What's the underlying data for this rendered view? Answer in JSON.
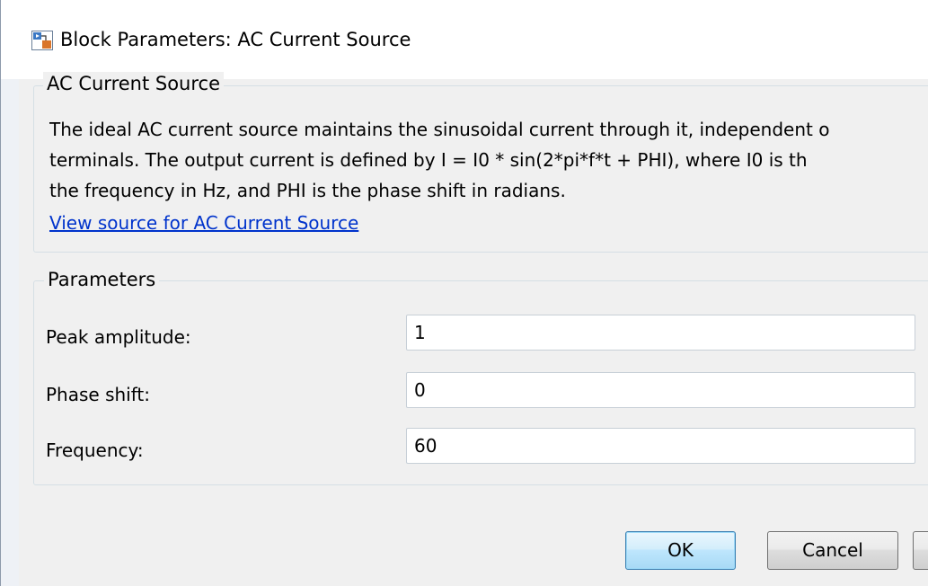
{
  "window": {
    "title": "Block Parameters: AC Current Source",
    "icon": "simulink-block-icon"
  },
  "description_group": {
    "title": "AC Current Source",
    "lines": [
      "The ideal AC current source maintains the sinusoidal current through it, independent o",
      "terminals. The output current is defined by I = I0 * sin(2*pi*f*t + PHI), where I0 is th",
      "the frequency in Hz, and PHI is the phase shift in radians."
    ],
    "link": "View source for AC Current Source"
  },
  "parameters_group": {
    "title": "Parameters",
    "fields": [
      {
        "label": "Peak amplitude:",
        "value": "1"
      },
      {
        "label": "Phase shift:",
        "value": "0"
      },
      {
        "label": "Frequency:",
        "value": "60"
      }
    ]
  },
  "buttons": {
    "ok": "OK",
    "cancel": "Cancel"
  },
  "colors": {
    "link": "#0033cc",
    "ok_border": "#3c7fb1"
  }
}
